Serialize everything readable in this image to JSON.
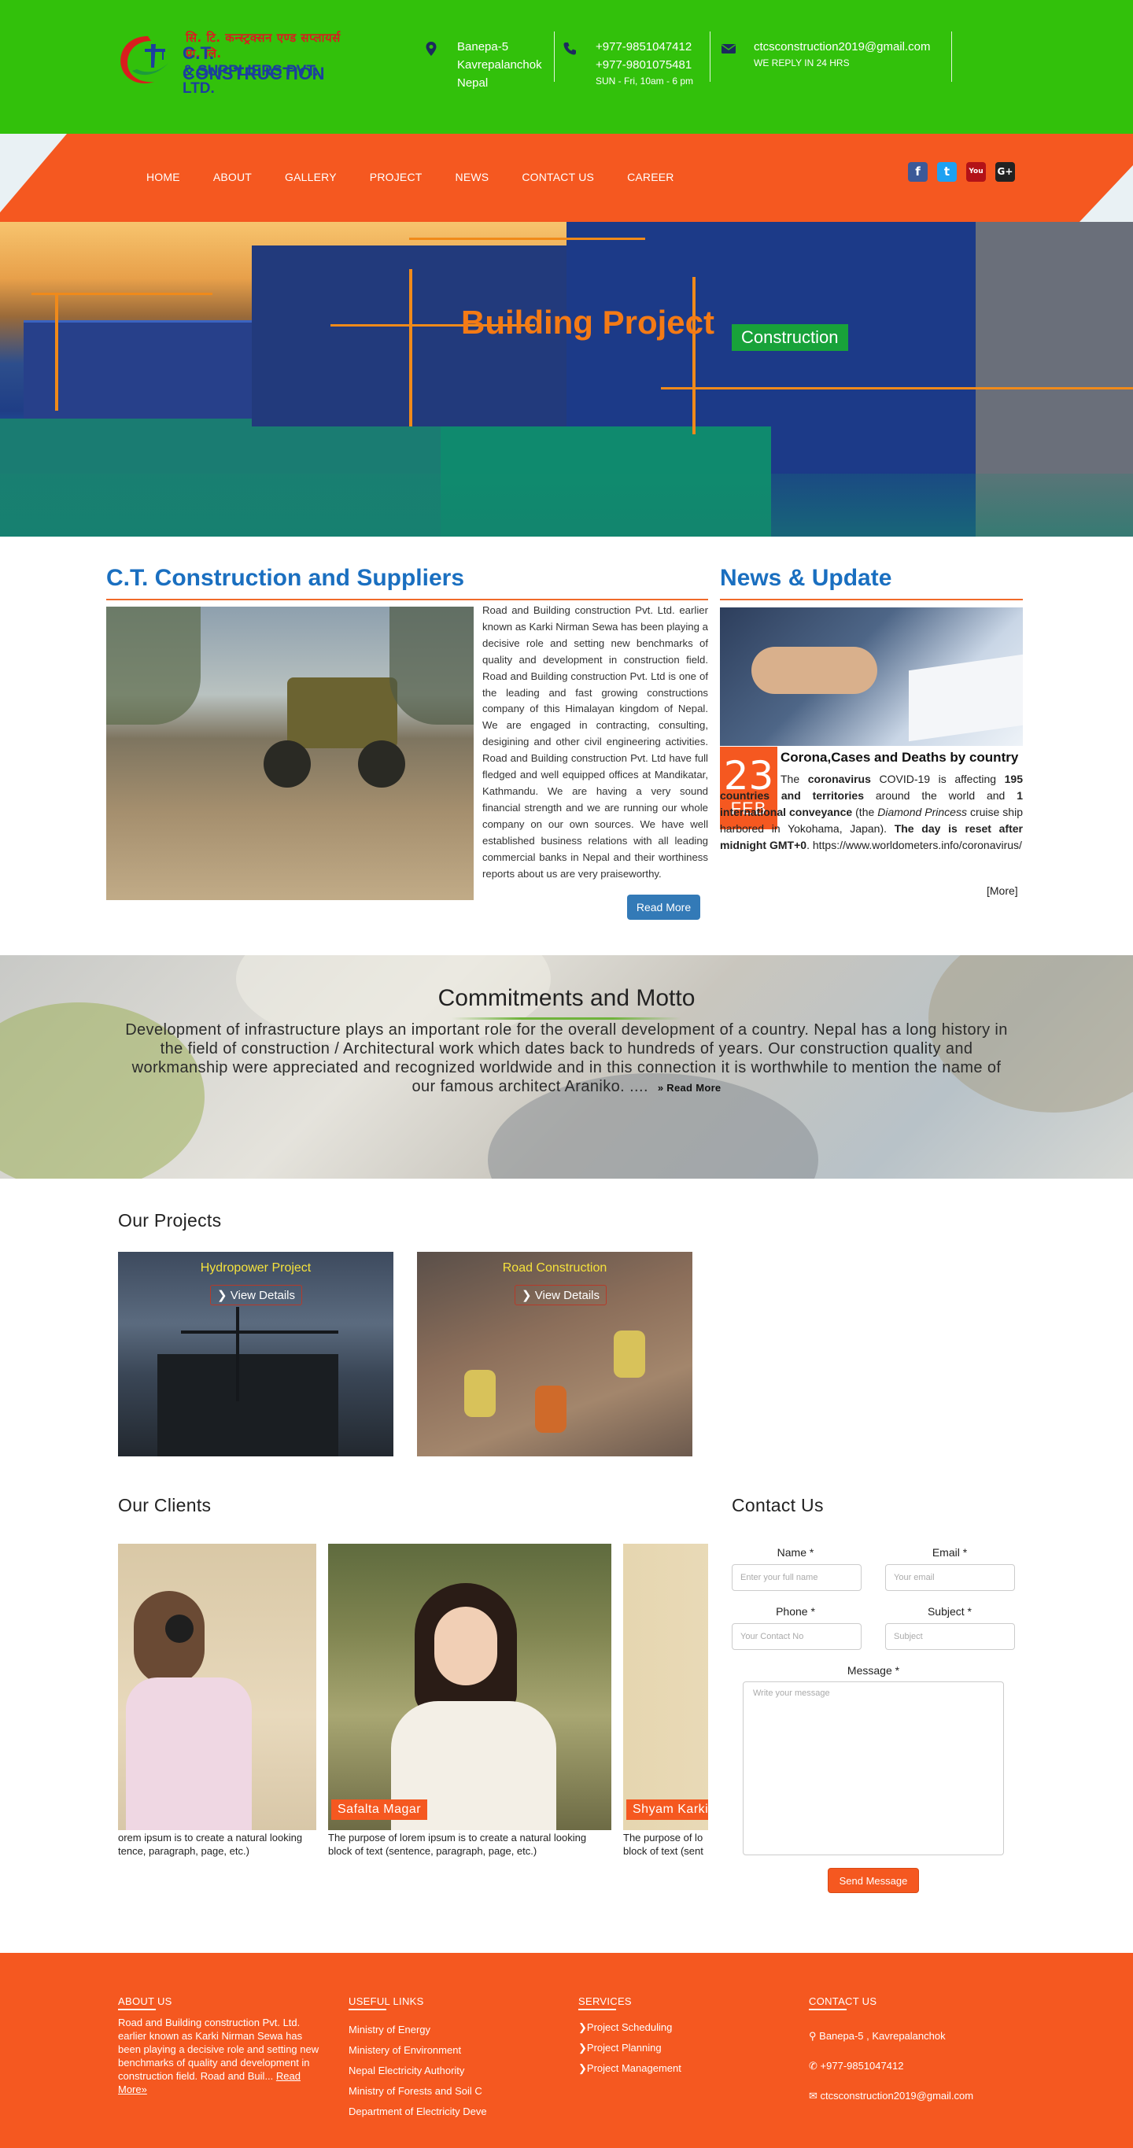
{
  "brand": {
    "nepali_name": "सि. टि. कन्स्ट्रक्सन एण्ड सप्लायर्स प्रा. लि.",
    "line1": "C.T. CONSTRUCTION",
    "line2": "& SUPPLIERS PVT. LTD."
  },
  "header_info": {
    "address": [
      "Banepa-5",
      "Kavrepalanchok",
      "Nepal"
    ],
    "phones": [
      "+977-9851047412",
      "+977-9801075481"
    ],
    "hours": "SUN - Fri, 10am - 6 pm",
    "email": "ctcsconstruction2019@gmail.com",
    "reply": "WE REPLY IN 24 HRS"
  },
  "nav": [
    "HOME",
    "ABOUT",
    "GALLERY",
    "PROJECT",
    "NEWS",
    "CONTACT US",
    "CAREER"
  ],
  "social": [
    {
      "name": "facebook",
      "glyph": "f",
      "color": "#3b5998"
    },
    {
      "name": "twitter",
      "glyph": "t",
      "color": "#1da1f2"
    },
    {
      "name": "youtube",
      "glyph": "You",
      "color": "#b31217"
    },
    {
      "name": "google-plus",
      "glyph": "G+",
      "color": "#222222"
    }
  ],
  "hero": {
    "title": "Building Project",
    "tag": "Construction"
  },
  "about": {
    "title": "C.T. Construction and Suppliers",
    "text": "Road and Building construction Pvt. Ltd. earlier known as Karki Nirman Sewa has been playing a decisive role and setting new benchmarks of quality and development in construction field. Road and Building construction Pvt. Ltd is one of the leading and fast growing constructions company of this Himalayan kingdom of Nepal. We are engaged in contracting, consulting, desigining and other civil engineering activities. Road and Building construction Pvt. Ltd have full fledged and well equipped offices at Mandikatar, Kathmandu. We are having a very sound financial strength and we are running our whole company on our own sources. We have well established business relations with all leading commercial banks in Nepal and their worthiness reports about us are very praiseworthy.",
    "button": "Read More"
  },
  "news": {
    "title": "News & Update",
    "day": "23",
    "month": "FEB",
    "headline": "Corona,Cases and Deaths by country",
    "body": {
      "p1": "The ",
      "b1": "coronavirus",
      "p2": " COVID-19 is affecting ",
      "b2": "195 countries and territories",
      "p3": " around the world and ",
      "b3": "1 international conveyance",
      "p4": " (the ",
      "i1": "Diamond Princess",
      "p5": " cruise ship harbored in Yokohama, Japan). ",
      "b4": "The day is reset after midnight GMT+0",
      "p6": ". https://www.worldometers.info/coronavirus/"
    },
    "more": "[More]"
  },
  "motto": {
    "title": "Commitments and Motto",
    "text": "Development of infrastructure plays an important role for the overall development of a country. Nepal has a long history in the field of construction / Architectural work which dates back to hundreds of years. Our construction quality and workmanship were appreciated and recognized worldwide and in this connection it is worthwhile to mention the name of our famous architect Araniko. ....",
    "read_more": "Read More"
  },
  "projects": {
    "title": "Our Projects",
    "items": [
      {
        "title": "Hydropower Project",
        "button": "View Details"
      },
      {
        "title": "Road Construction",
        "button": "View Details"
      }
    ]
  },
  "clients": {
    "title": "Our Clients",
    "items": [
      {
        "name": "",
        "desc_line1": "orem ipsum is to create a natural looking",
        "desc_line2": "tence, paragraph, page, etc.)"
      },
      {
        "name": "Safalta Magar",
        "desc_line1": "The purpose of lorem ipsum is to create a natural looking",
        "desc_line2": "block of text (sentence, paragraph, page, etc.)"
      },
      {
        "name": "Shyam Karki",
        "desc_line1": "The purpose of lo",
        "desc_line2": "block of text (sent"
      }
    ]
  },
  "contact": {
    "title": "Contact Us",
    "name_label": "Name *",
    "name_placeholder": "Enter your full name",
    "email_label": "Email *",
    "email_placeholder": "Your email",
    "phone_label": "Phone *",
    "phone_placeholder": "Your Contact No",
    "subject_label": "Subject *",
    "subject_placeholder": "Subject",
    "message_label": "Message *",
    "message_placeholder": "Write your message",
    "button": "Send Message"
  },
  "footer": {
    "about_title": "ABOUT US",
    "about_text": "Road and Building construction Pvt. Ltd. earlier known as Karki Nirman Sewa has been playing a decisive role and setting new benchmarks of quality and development in construction field. Road and Buil...",
    "about_link": "Read More»",
    "links_title": "USEFUL LINKS",
    "links": [
      "Ministry of Energy",
      "Ministery of Environment",
      "Nepal Electricity Authority",
      "Ministry of Forests and Soil C",
      "Department of Electricity Deve"
    ],
    "services_title": "SERVICES",
    "services": [
      "Project Scheduling",
      "Project Planning",
      "Project Management"
    ],
    "contact_title": "CONTACT US",
    "contact_address": "Banepa-5 , Kavrepalanchok",
    "contact_phone": "+977-9851047412",
    "contact_email": "ctcsconstruction2019@gmail.com"
  }
}
